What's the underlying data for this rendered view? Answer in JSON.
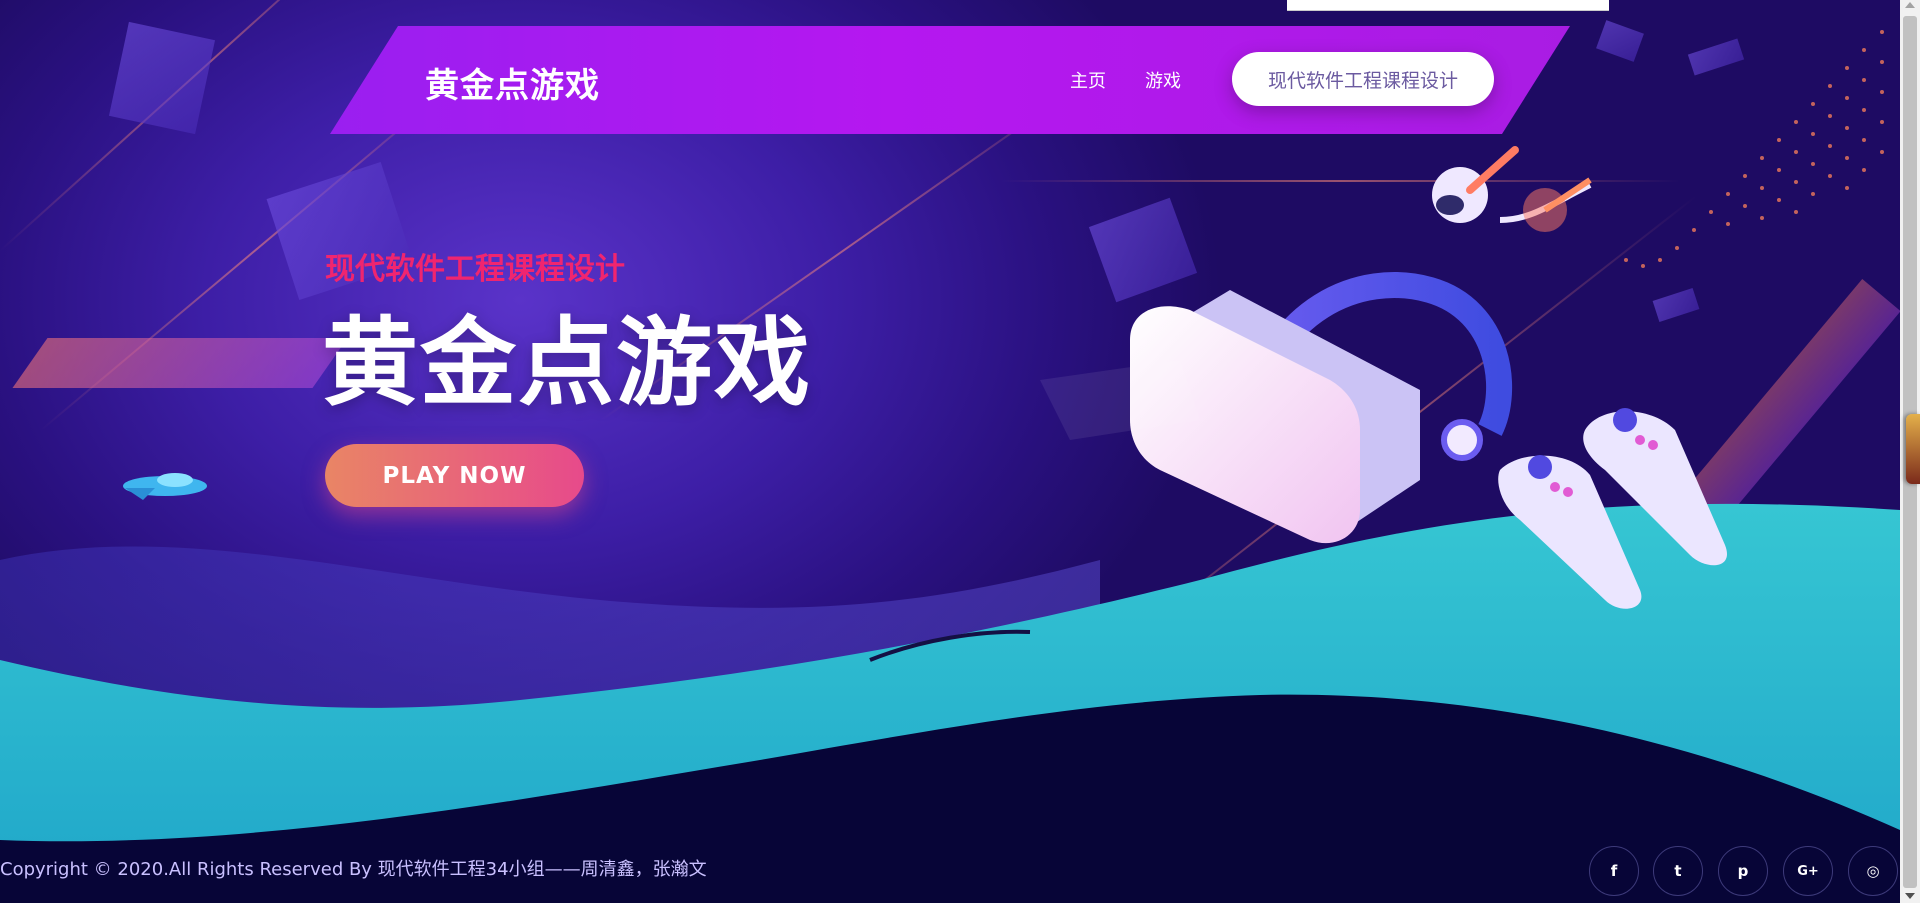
{
  "header": {
    "brand": "黄金点游戏",
    "nav": [
      {
        "label": "主页"
      },
      {
        "label": "游戏"
      }
    ],
    "cta_label": "现代软件工程课程设计"
  },
  "hero": {
    "eyebrow": "现代软件工程课程设计",
    "title": "黄金点游戏",
    "button_label": "PLAY NOW"
  },
  "footer": {
    "copyright": "Copyright © 2020.All Rights Reserved By 现代软件工程34小组——周清鑫，张瀚文",
    "social": [
      {
        "icon": "facebook-icon",
        "glyph": "f"
      },
      {
        "icon": "twitter-icon",
        "glyph": "t"
      },
      {
        "icon": "pinterest-icon",
        "glyph": "p"
      },
      {
        "icon": "google-plus-icon",
        "glyph": "G+"
      },
      {
        "icon": "instagram-icon",
        "glyph": "◎"
      }
    ]
  },
  "colors": {
    "header_purple": "#b517f0",
    "accent_pink": "#f0256f",
    "button_gradient_start": "#e98565",
    "button_gradient_end": "#e74a8b",
    "wave_teal": "#27b2cc",
    "footer_navy": "#070537"
  }
}
